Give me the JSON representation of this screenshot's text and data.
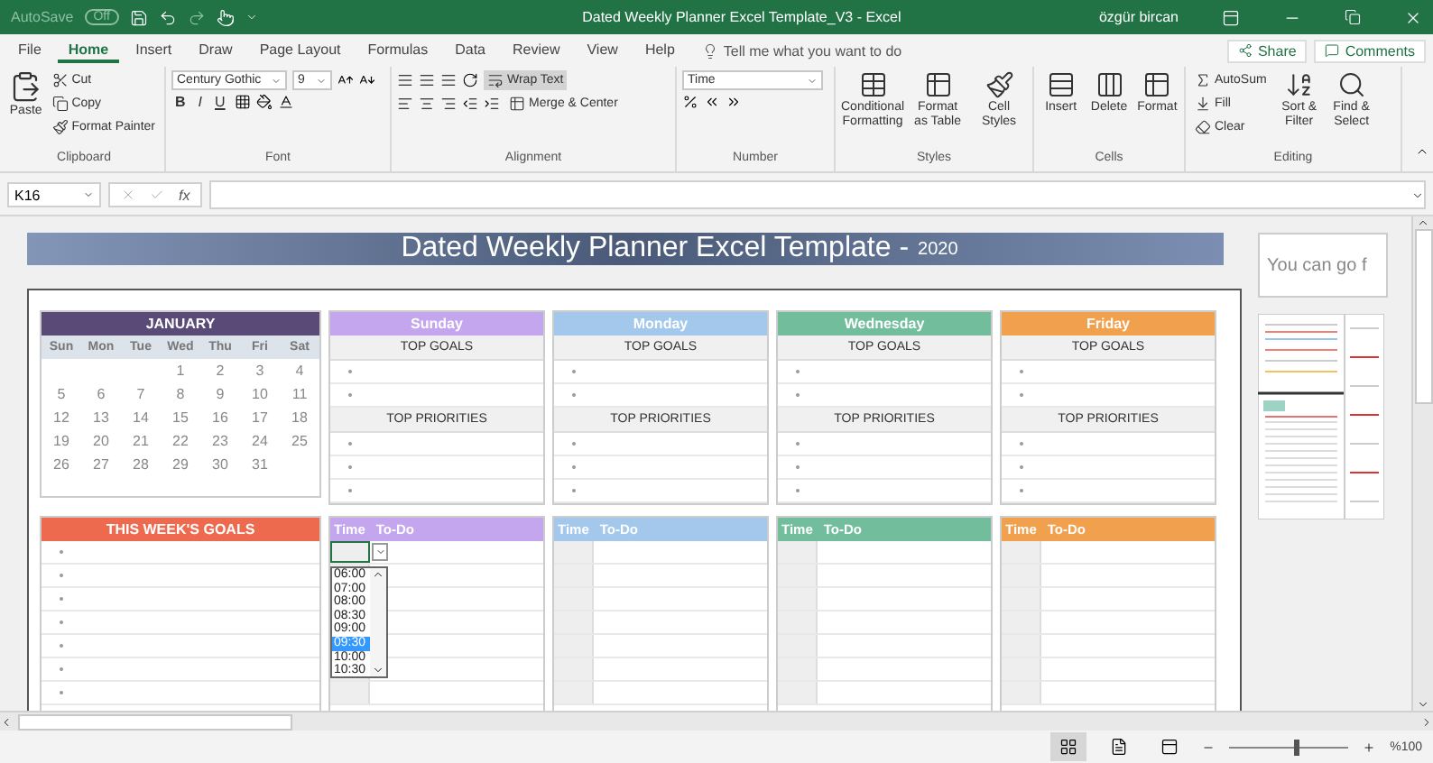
{
  "window": {
    "autosave": {
      "label": "AutoSave",
      "toggle": "Off",
      "on": false
    },
    "title": "Dated Weekly Planner Excel Template_V3 - Excel",
    "user": "özgür bircan"
  },
  "tabs": [
    {
      "label": "File",
      "selected": false
    },
    {
      "label": "Home",
      "selected": true
    },
    {
      "label": "Insert",
      "selected": false
    },
    {
      "label": "Draw",
      "selected": false
    },
    {
      "label": "Page Layout",
      "selected": false
    },
    {
      "label": "Formulas",
      "selected": false
    },
    {
      "label": "Data",
      "selected": false
    },
    {
      "label": "Review",
      "selected": false
    },
    {
      "label": "View",
      "selected": false
    },
    {
      "label": "Help",
      "selected": false
    }
  ],
  "search": {
    "placeholder": "Tell me what you want to do"
  },
  "actions": {
    "share": "Share",
    "comments": "Comments"
  },
  "ribbon": {
    "clipboard": {
      "label": "Clipboard",
      "paste": "Paste",
      "cut": "Cut",
      "copy": "Copy",
      "format_painter": "Format Painter"
    },
    "font": {
      "label": "Font",
      "font_name": "Century Gothic",
      "font_size": "9",
      "bold": "B",
      "italic": "I",
      "underline": "U"
    },
    "alignment": {
      "label": "Alignment",
      "wrap_text": {
        "label": "Wrap Text",
        "on": true
      },
      "merge": "Merge & Center"
    },
    "number": {
      "label": "Number",
      "format": "Time"
    },
    "styles": {
      "label": "Styles",
      "buttons": [
        "Conditional Formatting",
        "Format as Table",
        "Cell Styles"
      ]
    },
    "cells": {
      "label": "Cells",
      "buttons": [
        "Insert",
        "Delete",
        "Format"
      ]
    },
    "editing": {
      "label": "Editing",
      "autosum": "AutoSum",
      "fill": "Fill",
      "clear": "Clear",
      "buttons": [
        "Sort & Filter",
        "Find & Select"
      ]
    }
  },
  "formula_bar": {
    "name_box": "K16",
    "function_label": "fx"
  },
  "sheet": {
    "banner": {
      "title": "Dated Weekly Planner Excel Template -",
      "year": "2020"
    },
    "side_note": "You can go f",
    "calendar": {
      "month": "JANUARY",
      "weekdays": [
        "Sun",
        "Mon",
        "Tue",
        "Wed",
        "Thu",
        "Fri",
        "Sat"
      ],
      "weeks": [
        [
          "1",
          "2",
          "3",
          "4"
        ],
        [
          "5",
          "6",
          "7",
          "8",
          "9",
          "10",
          "11"
        ],
        [
          "12",
          "13",
          "14",
          "15",
          "16",
          "17",
          "18"
        ],
        [
          "19",
          "20",
          "21",
          "22",
          "23",
          "24",
          "25"
        ],
        [
          "26",
          "27",
          "28",
          "29",
          "30",
          "31"
        ]
      ]
    },
    "days": [
      {
        "name": "Sunday",
        "color": "#c4a6ef",
        "goals_label": "TOP GOALS",
        "priorities_label": "TOP PRIORITIES",
        "time_label": "Time",
        "todo_label": "To-Do"
      },
      {
        "name": "Monday",
        "color": "#a3c8ec",
        "goals_label": "TOP GOALS",
        "priorities_label": "TOP PRIORITIES",
        "time_label": "Time",
        "todo_label": "To-Do"
      },
      {
        "name": "Wednesday",
        "color": "#71bd9c",
        "goals_label": "TOP GOALS",
        "priorities_label": "TOP PRIORITIES",
        "time_label": "Time",
        "todo_label": "To-Do"
      },
      {
        "name": "Friday",
        "color": "#f1a04e",
        "goals_label": "TOP GOALS",
        "priorities_label": "TOP PRIORITIES",
        "time_label": "Time",
        "todo_label": "To-Do"
      }
    ],
    "week_goals": {
      "label": "THIS WEEK'S GOALS"
    },
    "time_dropdown": {
      "options": [
        {
          "label": "06:00",
          "selected": false
        },
        {
          "label": "07:00",
          "selected": false
        },
        {
          "label": "08:00",
          "selected": false
        },
        {
          "label": "08:30",
          "selected": false
        },
        {
          "label": "09:00",
          "selected": false
        },
        {
          "label": "09:30",
          "selected": true
        },
        {
          "label": "10:00",
          "selected": false
        },
        {
          "label": "10:30",
          "selected": false
        }
      ]
    }
  },
  "status_bar": {
    "views": [
      {
        "kind": "normal",
        "selected": true
      },
      {
        "kind": "page_layout",
        "selected": false
      },
      {
        "kind": "page_break",
        "selected": false
      }
    ],
    "zoom": {
      "label": "%100",
      "level": 0.55
    }
  }
}
